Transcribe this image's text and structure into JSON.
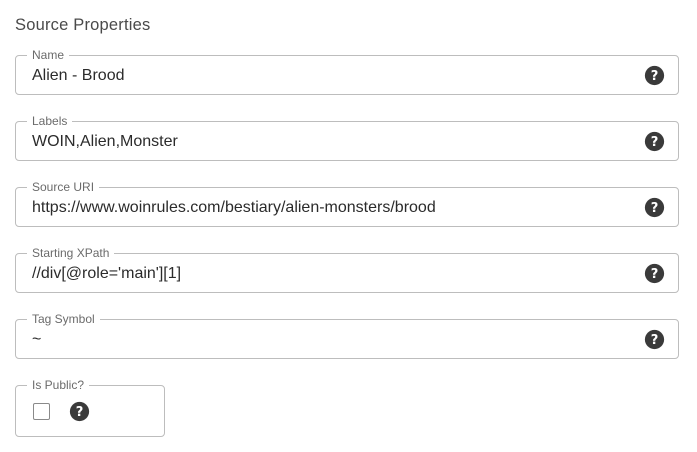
{
  "section": {
    "title": "Source Properties"
  },
  "fields": {
    "name": {
      "label": "Name",
      "value": "Alien - Brood"
    },
    "labels": {
      "label": "Labels",
      "value": "WOIN,Alien,Monster"
    },
    "source_uri": {
      "label": "Source URI",
      "value": "https://www.woinrules.com/bestiary/alien-monsters/brood"
    },
    "starting_xpath": {
      "label": "Starting XPath",
      "value": "//div[@role='main'][1]"
    },
    "tag_symbol": {
      "label": "Tag Symbol",
      "value": "~"
    }
  },
  "is_public": {
    "label": "Is Public?",
    "checked": false
  },
  "icons": {
    "help": "help-circle-icon",
    "checkbox": "checkbox-unchecked-icon"
  },
  "colors": {
    "border": "#bdbdbd",
    "label": "#6b6b6b",
    "text": "#2b2b2b",
    "icon": "#3a3a3a"
  }
}
